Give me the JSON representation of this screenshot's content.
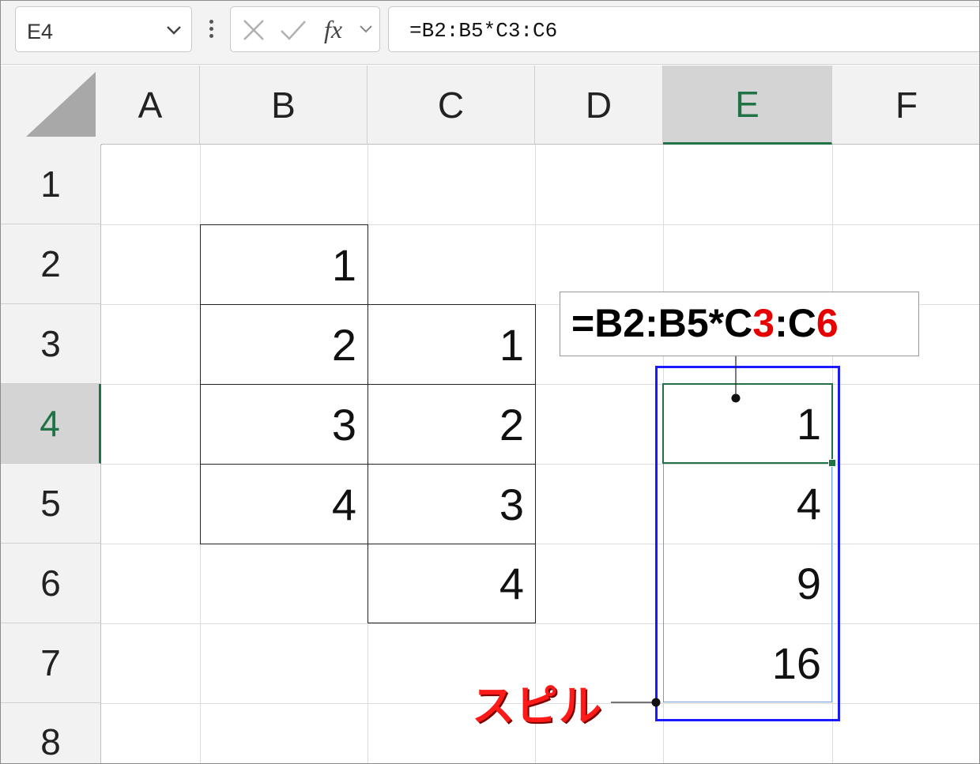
{
  "formula_bar": {
    "name_box": "E4",
    "fx_label": "fx",
    "formula": "=B2:B5*C3:C6"
  },
  "columns": [
    "A",
    "B",
    "C",
    "D",
    "E",
    "F"
  ],
  "rows": [
    "1",
    "2",
    "3",
    "4",
    "5",
    "6",
    "7",
    "8"
  ],
  "active_cell": {
    "column": "E",
    "row": "4"
  },
  "cells": {
    "B2": "1",
    "B3": "2",
    "B4": "3",
    "B5": "4",
    "C3": "1",
    "C4": "2",
    "C5": "3",
    "C6": "4",
    "E4": "1",
    "E5": "4",
    "E6": "9",
    "E7": "16"
  },
  "annotation": {
    "formula_prefix": "=B2:B5*C",
    "red_1": "3",
    "mid": ":C",
    "red_2": "6",
    "spill_label": "スピル"
  },
  "colors": {
    "accent_green": "#217346",
    "spill_blue": "#1a1aff",
    "highlight_red": "#e60000"
  }
}
